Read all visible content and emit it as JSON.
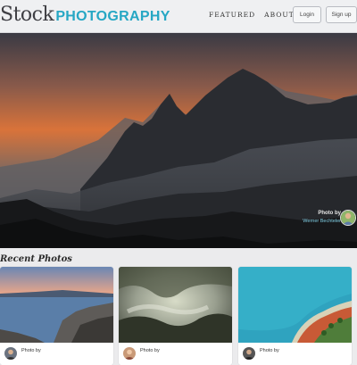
{
  "header": {
    "logo_stock": "Stock",
    "logo_photography": "PHOTOGRAPHY",
    "nav": [
      "FEATURED",
      "ABOUT"
    ],
    "login_label": "Login",
    "signup_label": "Sign up"
  },
  "hero": {
    "credit_label": "Photo by",
    "credit_name": "Werner Bechteler"
  },
  "recent": {
    "title": "Recent Photos",
    "cards": [
      {
        "credit_label": "Photo by"
      },
      {
        "credit_label": "Photo by"
      },
      {
        "credit_label": "Photo by"
      }
    ]
  },
  "colors": {
    "accent": "#26a7c4",
    "header_bg": "#eff0f2",
    "page_bg": "#ebebed"
  }
}
